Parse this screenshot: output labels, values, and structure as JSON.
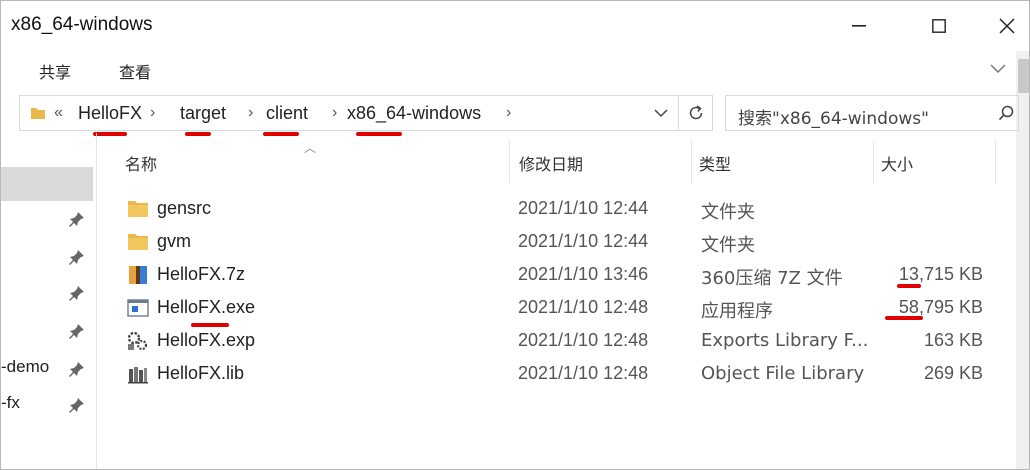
{
  "window": {
    "title": "x86_64-windows",
    "controls": {
      "minimize": "minimize",
      "maximize": "maximize",
      "close": "close"
    }
  },
  "ribbon": {
    "tabs": [
      "共享",
      "查看"
    ]
  },
  "address": {
    "overflow": "«",
    "crumbs": [
      "HelloFX",
      "target",
      "client",
      "x86_64-windows"
    ],
    "separator": "›"
  },
  "search": {
    "placeholder": "搜索\"x86_64-windows\""
  },
  "nav": {
    "items": [
      "-demo",
      "-fx"
    ]
  },
  "columns": {
    "name": "名称",
    "date": "修改日期",
    "type": "类型",
    "size": "大小"
  },
  "files": [
    {
      "name": "gensrc",
      "date": "2021/1/10 12:44",
      "type": "文件夹",
      "size": "",
      "icon": "folder-icon"
    },
    {
      "name": "gvm",
      "date": "2021/1/10 12:44",
      "type": "文件夹",
      "size": "",
      "icon": "folder-icon"
    },
    {
      "name": "HelloFX.7z",
      "date": "2021/1/10 13:46",
      "type": "360压缩 7Z 文件",
      "size": "13,715 KB",
      "icon": "archive-icon"
    },
    {
      "name": "HelloFX.exe",
      "date": "2021/1/10 12:48",
      "type": "应用程序",
      "size": "58,795 KB",
      "icon": "exe-icon"
    },
    {
      "name": "HelloFX.exp",
      "date": "2021/1/10 12:48",
      "type": "Exports Library F...",
      "size": "163 KB",
      "icon": "exp-file-icon"
    },
    {
      "name": "HelloFX.lib",
      "date": "2021/1/10 12:48",
      "type": "Object File Library",
      "size": "269 KB",
      "icon": "lib-file-icon"
    }
  ],
  "colors": {
    "annotation": "#e00000",
    "folder": "#e8b94a",
    "selection": "#d9d9d9"
  }
}
